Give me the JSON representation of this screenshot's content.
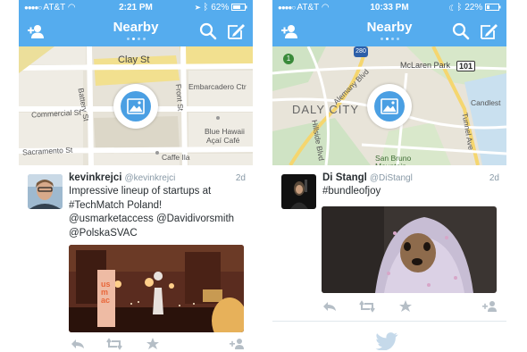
{
  "colors": {
    "twitter_blue": "#55acee",
    "text": "#292f33",
    "meta": "#8899a6",
    "action": "#b5bec6"
  },
  "phones": [
    {
      "status": {
        "carrier": "AT&T",
        "time": "2:21 PM",
        "battery": "62%"
      },
      "nav": {
        "title": "Nearby"
      },
      "map": {
        "labels": [
          "Clay St",
          "Commercial St",
          "Battery St",
          "Front St",
          "Embarcadero Ctr",
          "Sacramento St",
          "Blue Hawaii",
          "Açaí Café",
          "Caffe Ila"
        ]
      },
      "tweet": {
        "name": "kevinkrejci",
        "handle": "@kevinkrejci",
        "time": "2d",
        "text_lines": [
          "Impressive lineup of startups at",
          "#TechMatch Poland!",
          "@usmarketaccess  @Davidivorsmith",
          "@PolskaSVAC"
        ],
        "media_banner": "us mac"
      }
    },
    {
      "status": {
        "carrier": "AT&T",
        "time": "10:33 PM",
        "battery": "22%"
      },
      "nav": {
        "title": "Nearby"
      },
      "map": {
        "labels": [
          "McLaren Park",
          "Daly City",
          "Alemany Blvd",
          "Hillside Blvd",
          "San Bruno Mountain",
          "Tunnel Ave",
          "Candlest",
          "101",
          "1",
          "280"
        ]
      },
      "tweet": {
        "name": "Di Stangl",
        "handle": "@DiStangl",
        "time": "2d",
        "text_lines": [
          "#bundleofjoy"
        ]
      }
    }
  ],
  "icons": [
    "add-user-icon",
    "search-icon",
    "compose-icon",
    "photo-icon",
    "reply-icon",
    "retweet-icon",
    "favorite-icon",
    "follow-icon",
    "twitter-bird-icon",
    "wifi-icon",
    "location-icon",
    "bluetooth-icon",
    "battery-icon"
  ]
}
